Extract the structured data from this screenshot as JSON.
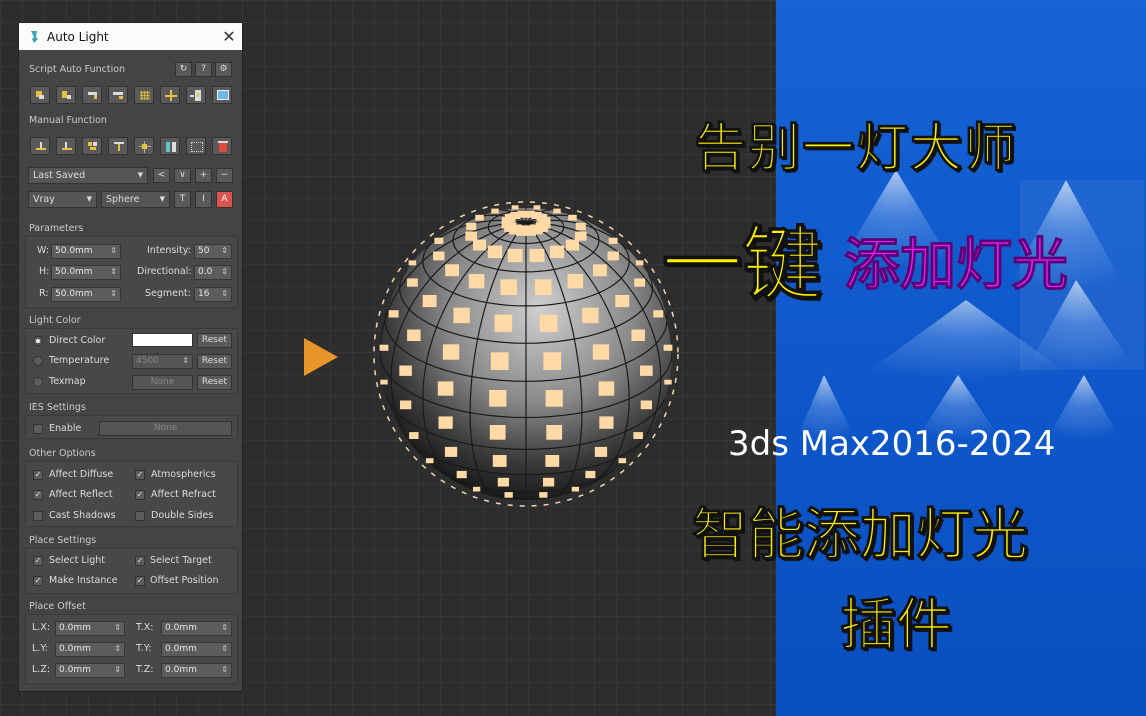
{
  "panel": {
    "title": "Auto Light",
    "close": "✕",
    "script_section": "Script Auto Function",
    "header_buttons": [
      "↻",
      "?",
      "⚙"
    ],
    "manual_section": "Manual Function",
    "last_saved": "Last Saved",
    "nav_buttons": [
      "<",
      "∨",
      "+",
      "−"
    ],
    "renderer": "Vray",
    "shape": "Sphere",
    "mode_buttons": [
      "T",
      "I",
      "A"
    ]
  },
  "parameters": {
    "title": "Parameters",
    "w_label": "W:",
    "w": "50.0mm",
    "h_label": "H:",
    "h": "50.0mm",
    "r_label": "R:",
    "r": "50.0mm",
    "intensity_label": "Intensity:",
    "intensity": "50",
    "directional_label": "Directional:",
    "directional": "0.0",
    "segment_label": "Segment:",
    "segment": "16"
  },
  "light_color": {
    "title": "Light Color",
    "direct_color": "Direct Color",
    "temperature": "Temperature",
    "temperature_value": "4500",
    "texmap": "Texmap",
    "texmap_value": "None",
    "reset": "Reset"
  },
  "ies": {
    "title": "IES Settings",
    "enable": "Enable",
    "file": "None"
  },
  "other": {
    "title": "Other Options",
    "affect_diffuse": "Affect Diffuse",
    "atmospherics": "Atmospherics",
    "affect_reflect": "Affect Reflect",
    "affect_refract": "Affect Refract",
    "cast_shadows": "Cast Shadows",
    "double_sides": "Double Sides"
  },
  "place": {
    "title": "Place Settings",
    "select_light": "Select Light",
    "select_target": "Select Target",
    "make_instance": "Make Instance",
    "offset_position": "Offset Position"
  },
  "offset": {
    "title": "Place Offset",
    "lx_label": "L.X:",
    "lx": "0.0mm",
    "ly_label": "L.Y:",
    "ly": "0.0mm",
    "lz_label": "L.Z:",
    "lz": "0.0mm",
    "tx_label": "T.X:",
    "tx": "0.0mm",
    "ty_label": "T.Y:",
    "ty": "0.0mm",
    "tz_label": "T.Z:",
    "tz": "0.0mm"
  },
  "promo": {
    "line1": "告别一灯大师",
    "line2a": "一键",
    "line2b": "添加灯光",
    "version": "3ds Max2016-2024",
    "line3": "智能添加灯光",
    "line4": "插件"
  },
  "colors": {
    "accent_yellow": "#fff200",
    "accent_magenta": "#e31fff",
    "blue": "#0d56c9",
    "arrow": "#e8952a"
  }
}
